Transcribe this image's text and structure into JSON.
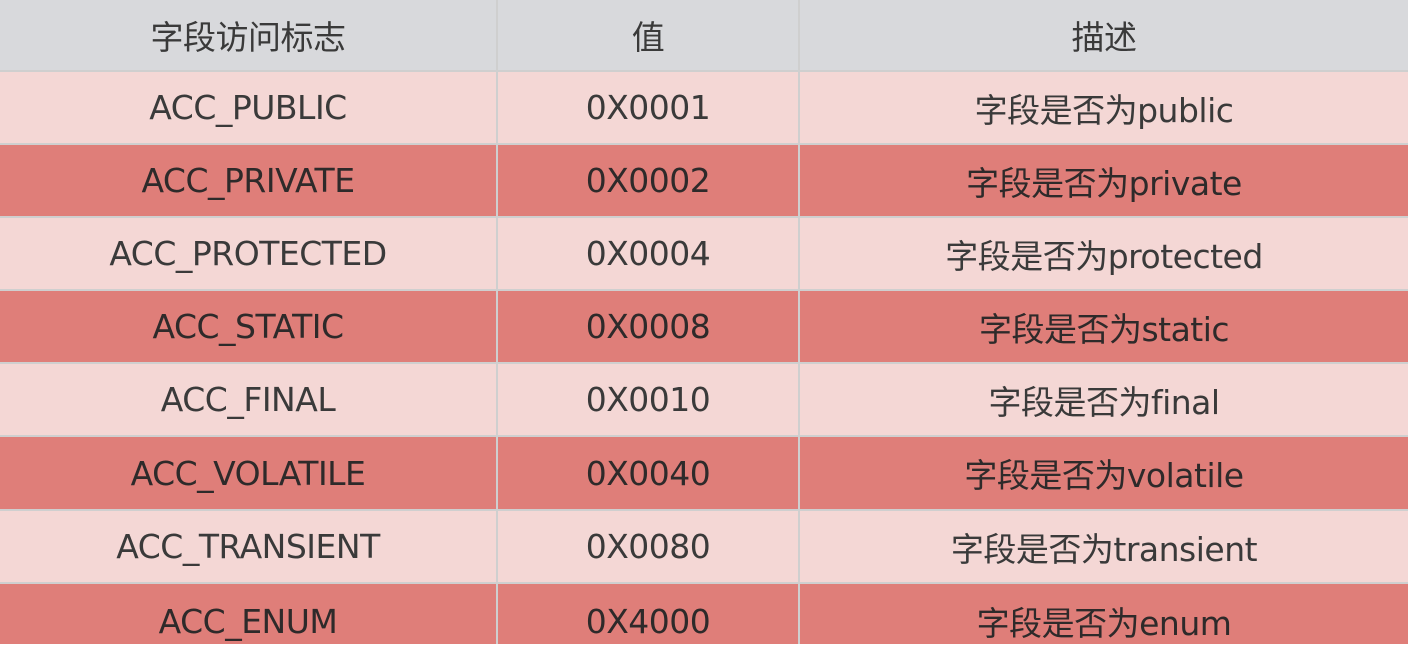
{
  "table": {
    "headers": [
      "字段访问标志",
      "值",
      "描述"
    ],
    "rows": [
      {
        "flag": "ACC_PUBLIC",
        "value": "0X0001",
        "desc": "字段是否为public"
      },
      {
        "flag": "ACC_PRIVATE",
        "value": "0X0002",
        "desc": "字段是否为private"
      },
      {
        "flag": "ACC_PROTECTED",
        "value": "0X0004",
        "desc": "字段是否为protected"
      },
      {
        "flag": "ACC_STATIC",
        "value": "0X0008",
        "desc": "字段是否为static"
      },
      {
        "flag": "ACC_FINAL",
        "value": "0X0010",
        "desc": "字段是否为final"
      },
      {
        "flag": "ACC_VOLATILE",
        "value": "0X0040",
        "desc": "字段是否为volatile"
      },
      {
        "flag": "ACC_TRANSIENT",
        "value": "0X0080",
        "desc": "字段是否为transient"
      },
      {
        "flag": "ACC_ENUM",
        "value": "0X4000",
        "desc": "字段是否为enum"
      }
    ]
  },
  "colors": {
    "header_bg": "#d8d9dc",
    "row_light": "#f4d7d5",
    "row_dark": "#df7e79",
    "grid_line": "#cfcfcf"
  }
}
